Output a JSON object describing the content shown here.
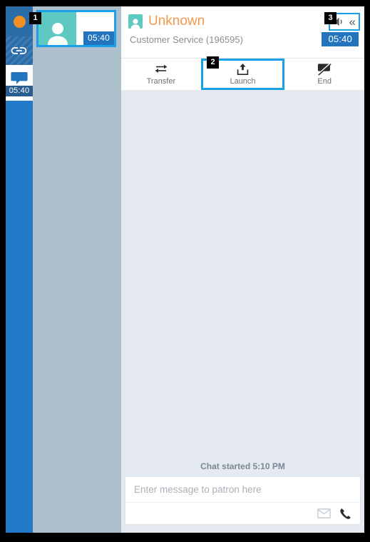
{
  "window": {
    "background": "#e4eaf0"
  },
  "rail": {
    "items": [
      {
        "name": "availability-status",
        "icon": "orange-dot-icon",
        "label": ""
      },
      {
        "name": "link-disabled",
        "icon": "chain-link-icon",
        "label": ""
      },
      {
        "name": "chat-channel",
        "icon": "chat-bubble-icon",
        "label": "05:40"
      }
    ]
  },
  "contacts": {
    "cards": [
      {
        "avatar_icon": "person-icon",
        "timer": "05:40",
        "selected": true
      }
    ]
  },
  "conversation": {
    "header": {
      "icon": "person-icon",
      "title": "Unknown",
      "subtitle": "Customer Service (196595)",
      "timer": "05:40",
      "tools": [
        {
          "name": "volume-icon",
          "glyph": "🔊"
        },
        {
          "name": "collapse-icon",
          "glyph": "«"
        }
      ]
    },
    "toolbar": [
      {
        "name": "transfer",
        "label": "Transfer",
        "icon": "transfer-arrows-icon",
        "selected": false
      },
      {
        "name": "launch",
        "label": "Launch",
        "icon": "upload-box-icon",
        "selected": true
      },
      {
        "name": "end",
        "label": "End",
        "icon": "chat-bubble-slash-icon",
        "selected": false
      }
    ],
    "body": {
      "system_note": "Chat started 5:10 PM",
      "messages": []
    },
    "composer": {
      "value": "",
      "placeholder": "Enter message to patron here",
      "actions": [
        {
          "name": "email-icon",
          "glyph": "✉"
        },
        {
          "name": "phone-icon",
          "glyph": "☎"
        }
      ]
    }
  },
  "annotations": {
    "badges": [
      {
        "id": "1",
        "target": "contact-card"
      },
      {
        "id": "2",
        "target": "launch-button"
      },
      {
        "id": "3",
        "target": "header-tools"
      }
    ]
  },
  "colors": {
    "rail_blue": "#2179c7",
    "contacts_gray": "#aebfcc",
    "accent_cyan": "#19a0e8",
    "timer_blue": "#2274be",
    "title_orange": "#f2994a",
    "avatar_teal": "#5ec9c1",
    "body_gray": "#e4eaf0"
  }
}
